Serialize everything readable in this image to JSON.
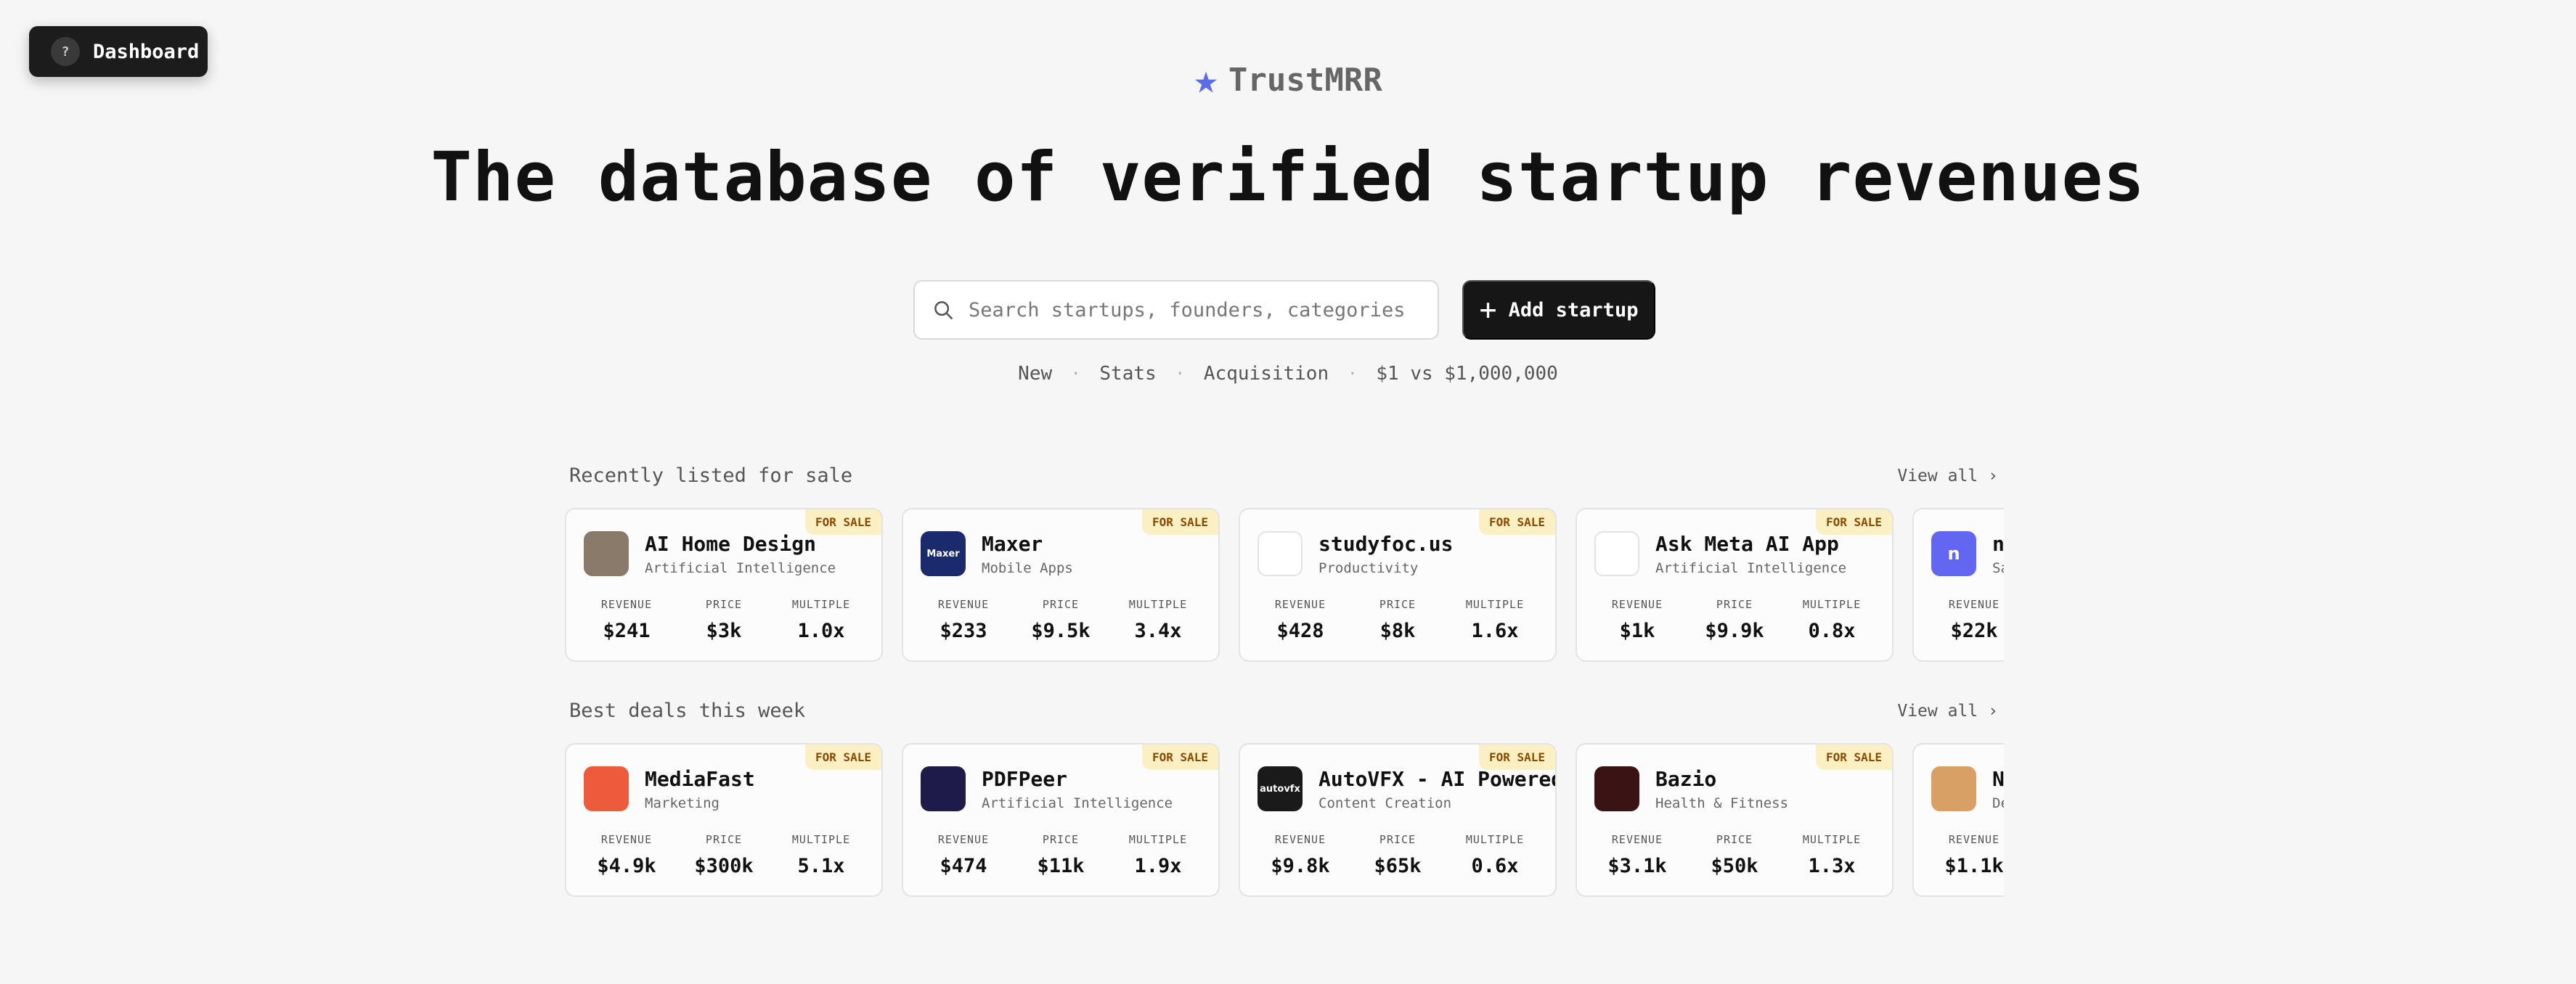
{
  "dashboard": {
    "label": "Dashboard",
    "help_glyph": "?"
  },
  "brand": {
    "name": "TrustMRR",
    "star_icon": "star-icon",
    "accent": "#5b6ee8"
  },
  "headline": "The database of verified startup revenues",
  "search": {
    "placeholder": "Search startups, founders, categories...",
    "value": ""
  },
  "add_startup": {
    "label": "Add startup"
  },
  "nav": [
    {
      "label": "New"
    },
    {
      "label": "Stats"
    },
    {
      "label": "Acquisition"
    },
    {
      "label": "$1 vs $1,000,000"
    }
  ],
  "badge_text": "FOR SALE",
  "metric_labels": {
    "revenue": "REVENUE",
    "price": "PRICE",
    "multiple": "MULTIPLE"
  },
  "sections": [
    {
      "title": "Recently listed for sale",
      "view_all": "View all",
      "cards": [
        {
          "name": "AI Home Design",
          "category": "Artificial Intelligence",
          "revenue": "$241",
          "price": "$3k",
          "multiple": "1.0x",
          "for_sale": true,
          "logo_text": "",
          "logo_color": "#8a7a6a"
        },
        {
          "name": "Maxer",
          "category": "Mobile Apps",
          "revenue": "$233",
          "price": "$9.5k",
          "multiple": "3.4x",
          "for_sale": true,
          "logo_text": "Maxer",
          "logo_color": "#1a2a6c"
        },
        {
          "name": "studyfoc.us",
          "category": "Productivity",
          "revenue": "$428",
          "price": "$8k",
          "multiple": "1.6x",
          "for_sale": true,
          "logo_text": "",
          "logo_color": "#ffffff"
        },
        {
          "name": "Ask Meta AI App",
          "category": "Artificial Intelligence",
          "revenue": "$1k",
          "price": "$9.9k",
          "multiple": "0.8x",
          "for_sale": true,
          "logo_text": "",
          "logo_color": "#ffffff"
        },
        {
          "name": "n",
          "category": "Sa",
          "revenue": "$22k",
          "price": "",
          "multiple": "",
          "for_sale": false,
          "logo_text": "n",
          "logo_color": "#6366f1"
        }
      ]
    },
    {
      "title": "Best deals this week",
      "view_all": "View all",
      "cards": [
        {
          "name": "MediaFast",
          "category": "Marketing",
          "revenue": "$4.9k",
          "price": "$300k",
          "multiple": "5.1x",
          "for_sale": true,
          "logo_text": "",
          "logo_color": "#ee5a3c"
        },
        {
          "name": "PDFPeer",
          "category": "Artificial Intelligence",
          "revenue": "$474",
          "price": "$11k",
          "multiple": "1.9x",
          "for_sale": true,
          "logo_text": "",
          "logo_color": "#1e1b4b"
        },
        {
          "name": "AutoVFX - AI Powered…",
          "category": "Content Creation",
          "revenue": "$9.8k",
          "price": "$65k",
          "multiple": "0.6x",
          "for_sale": true,
          "logo_text": "autovfx",
          "logo_color": "#1a1a1a"
        },
        {
          "name": "Bazio",
          "category": "Health & Fitness",
          "revenue": "$3.1k",
          "price": "$50k",
          "multiple": "1.3x",
          "for_sale": true,
          "logo_text": "",
          "logo_color": "#3a1414"
        },
        {
          "name": "N",
          "category": "De",
          "revenue": "$1.1k",
          "price": "",
          "multiple": "",
          "for_sale": false,
          "logo_text": "",
          "logo_color": "#d9a066"
        }
      ]
    }
  ]
}
